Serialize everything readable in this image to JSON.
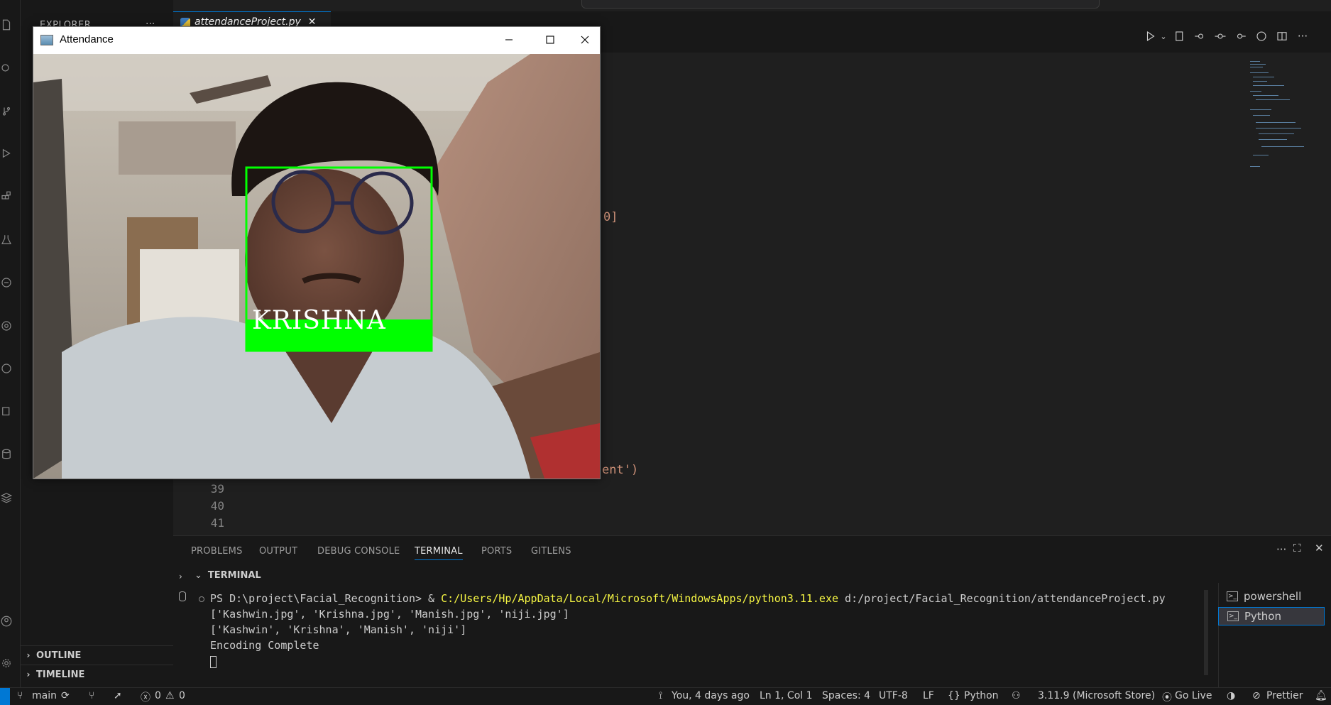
{
  "sidebar": {
    "title": "EXPLORER",
    "outline_label": "OUTLINE",
    "timeline_label": "TIMELINE"
  },
  "activity_icons": [
    "explorer-icon",
    "search-icon",
    "source-control-icon",
    "run-debug-icon",
    "extensions-icon",
    "testing-icon",
    "remote-explorer-icon",
    "gitlens-icon",
    "github-icon",
    "run-icon",
    "database-icon",
    "layers-icon",
    "account-icon",
    "settings-gear-icon"
  ],
  "editor": {
    "tab_label": "attendanceProject.py",
    "line_numbers": [
      "39",
      "40",
      "41"
    ],
    "code_fragment_1": "0]",
    "code_fragment_2": "ent')"
  },
  "panel": {
    "tabs": [
      "PROBLEMS",
      "OUTPUT",
      "DEBUG CONSOLE",
      "TERMINAL",
      "PORTS",
      "GITLENS"
    ],
    "active_tab": "TERMINAL",
    "section_title": "TERMINAL",
    "terminal": {
      "prompt": "PS D:\\project\\Facial_Recognition> & ",
      "exe_path": "C:/Users/Hp/AppData/Local/Microsoft/WindowsApps/python3.11.exe",
      "script_path": " d:/project/Facial_Recognition/attendanceProject.py",
      "line2": "['Kashwin.jpg', 'Krishna.jpg', 'Manish.jpg', 'niji.jpg']",
      "line3": "['Kashwin', 'Krishna', 'Manish', 'niji']",
      "line4": "Encoding Complete"
    },
    "terminal_list": [
      "powershell",
      "Python"
    ]
  },
  "statusbar": {
    "branch": "main",
    "errors": "0",
    "warnings": "0",
    "blame": "You, 4 days ago",
    "position": "Ln 1, Col 1",
    "spaces": "Spaces: 4",
    "encoding": "UTF-8",
    "eol": "LF",
    "language": "Python",
    "interpreter": "3.11.9 (Microsoft Store)",
    "go_live": "Go Live",
    "prettier": "Prettier"
  },
  "window": {
    "title": "Attendance",
    "face_label": "KRISHNA",
    "box_color": "#00ff00"
  }
}
